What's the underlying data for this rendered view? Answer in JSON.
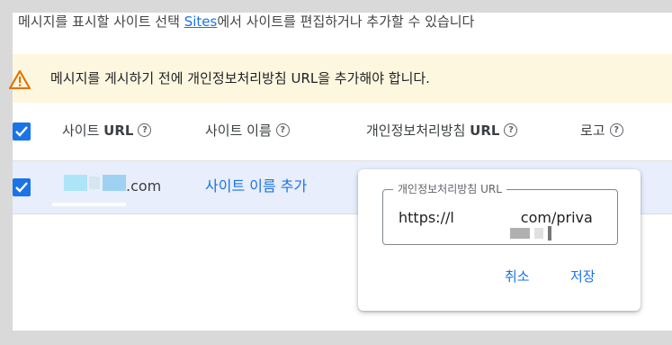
{
  "intro": {
    "before": "메시지를 표시할 사이트 선택 ",
    "link": "Sites",
    "after": "에서 사이트를 편집하거나 추가할 수 있습니다"
  },
  "banner": {
    "message": "메시지를 게시하기 전에 개인정보처리방침 URL을 추가해야 합니다.",
    "icon": "warning-icon",
    "color": "#fef7e0"
  },
  "table": {
    "headers": [
      {
        "label_prefix": "사이트 ",
        "label_bold": "URL"
      },
      {
        "label_prefix": "사이트 이름",
        "label_bold": ""
      },
      {
        "label_prefix": "개인정보처리방침 ",
        "label_bold": "URL"
      },
      {
        "label_prefix": "로고",
        "label_bold": ""
      }
    ],
    "help_glyph": "?",
    "rows": [
      {
        "checked": true,
        "domain_suffix": ".com",
        "name_action": "사이트 이름 추가"
      }
    ]
  },
  "popup": {
    "field_label": "개인정보처리방침 URL",
    "value_start": "https://l",
    "value_end": "com/priva",
    "cancel_label": "취소",
    "save_label": "저장"
  },
  "colors": {
    "accent": "#1a73e8",
    "warning": "#e37400",
    "row_selected": "#e8eefb"
  }
}
